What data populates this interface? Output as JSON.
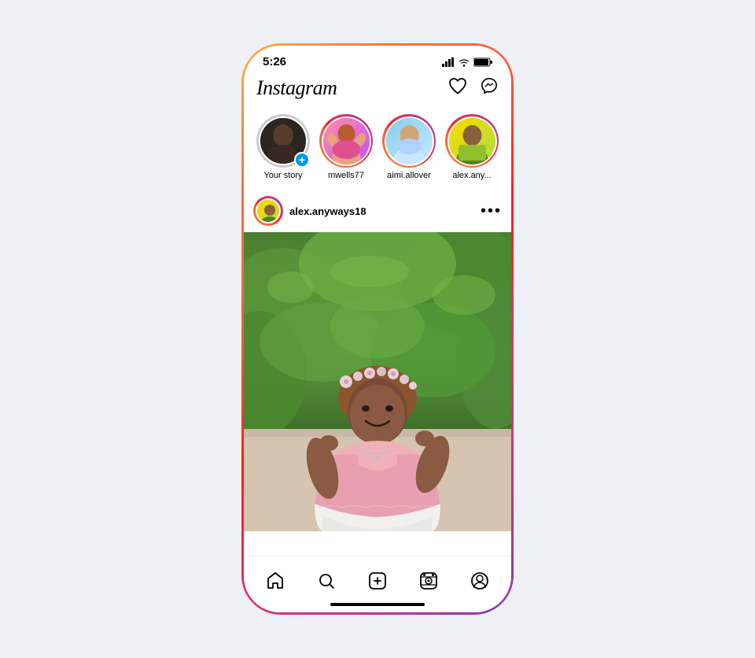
{
  "device": {
    "time": "5:26",
    "gradient_start": "#fcaf45",
    "gradient_end": "#833ab4"
  },
  "header": {
    "logo": "Instagram",
    "heart_icon": "♡",
    "messenger_icon": "✉"
  },
  "stories": [
    {
      "id": "your-story",
      "label": "Your story",
      "has_plus": true,
      "ring_color": "none"
    },
    {
      "id": "mwells",
      "label": "mwells77",
      "has_plus": false,
      "ring_color": "gradient"
    },
    {
      "id": "aimi",
      "label": "aimi.allover",
      "has_plus": false,
      "ring_color": "gradient"
    },
    {
      "id": "alex",
      "label": "alex.any...",
      "has_plus": false,
      "ring_color": "gradient"
    }
  ],
  "post": {
    "username": "alex.anyways18",
    "more_icon": "•••"
  },
  "nav": {
    "items": [
      {
        "id": "home",
        "icon": "⌂",
        "label": "Home"
      },
      {
        "id": "search",
        "icon": "🔍",
        "label": "Search"
      },
      {
        "id": "create",
        "icon": "⊕",
        "label": "Create"
      },
      {
        "id": "reels",
        "icon": "▶",
        "label": "Reels"
      },
      {
        "id": "profile",
        "icon": "◯",
        "label": "Profile"
      }
    ]
  }
}
